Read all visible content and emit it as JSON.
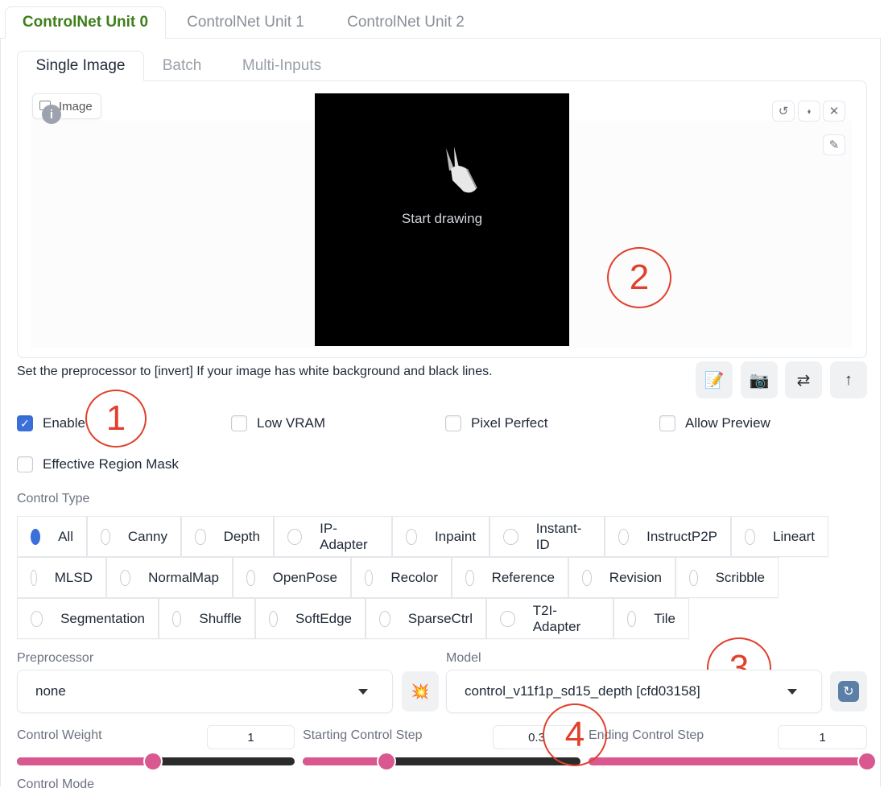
{
  "unit_tabs": [
    "ControlNet Unit 0",
    "ControlNet Unit 1",
    "ControlNet Unit 2"
  ],
  "mode_tabs": [
    "Single Image",
    "Batch",
    "Multi-Inputs"
  ],
  "image_label": "Image",
  "info_glyph": "i",
  "canvas_text": "Start drawing",
  "annotations": [
    "1",
    "2",
    "3",
    "4"
  ],
  "hint": "Set the preprocessor to [invert] If your image has white background and black lines.",
  "checkboxes": {
    "enable": "Enable",
    "low_vram": "Low VRAM",
    "pixel_perfect": "Pixel Perfect",
    "allow_preview": "Allow Preview",
    "effective_region_mask": "Effective Region Mask"
  },
  "checkbox_state": {
    "enable": true,
    "low_vram": false,
    "pixel_perfect": false,
    "allow_preview": false,
    "effective_region_mask": false
  },
  "control_type_label": "Control Type",
  "control_types": [
    "All",
    "Canny",
    "Depth",
    "IP-Adapter",
    "Inpaint",
    "Instant-ID",
    "InstructP2P",
    "Lineart",
    "MLSD",
    "NormalMap",
    "OpenPose",
    "Recolor",
    "Reference",
    "Revision",
    "Scribble",
    "Segmentation",
    "Shuffle",
    "SoftEdge",
    "SparseCtrl",
    "T2I-Adapter",
    "Tile"
  ],
  "control_type_selected": "All",
  "preprocessor": {
    "label": "Preprocessor",
    "value": "none"
  },
  "model": {
    "label": "Model",
    "value": "control_v11f1p_sd15_depth [cfd03158]"
  },
  "sliders": {
    "weight": {
      "label": "Control Weight",
      "value": "1",
      "fraction": 0.49
    },
    "start": {
      "label": "Starting Control Step",
      "value": "0.3",
      "fraction": 0.3
    },
    "end": {
      "label": "Ending Control Step",
      "value": "1",
      "fraction": 1.0
    }
  },
  "control_mode_label": "Control Mode",
  "colors": {
    "accent": "#d9588f",
    "active_tab": "#3f7f1c",
    "annotation": "#e0402c",
    "checkbox": "#3b6fd9"
  },
  "icons": [
    "image-icon",
    "info-icon",
    "hand-draw-icon",
    "undo-icon",
    "eraser-icon",
    "close-icon",
    "brush-icon",
    "edit-icon",
    "camera-icon",
    "swap-icon",
    "upload-icon",
    "explode-icon",
    "refresh-icon"
  ]
}
